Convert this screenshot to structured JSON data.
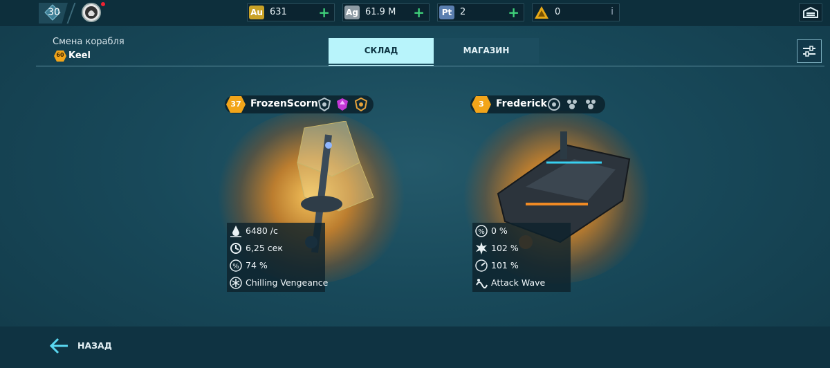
{
  "player": {
    "level": "30"
  },
  "resources": [
    {
      "code": "Au",
      "value": "631",
      "color": "#c9a227",
      "action": "plus"
    },
    {
      "code": "Ag",
      "value": "61.9 M",
      "color": "#8d9aa3",
      "action": "plus"
    },
    {
      "code": "Pt",
      "value": "2",
      "color": "#5b7fb0",
      "action": "plus"
    },
    {
      "code": "warning-triangle",
      "value": "0",
      "color": "#e6a817",
      "action": "info"
    }
  ],
  "header": {
    "title": "Смена корабля",
    "current_ship": {
      "level": "60",
      "name": "Keel"
    }
  },
  "tabs": [
    {
      "label": "СКЛАД",
      "active": true
    },
    {
      "label": "МАГАЗИН",
      "active": false
    }
  ],
  "ships": [
    {
      "level": "37",
      "name": "FrozenScorn",
      "modules": [
        "shield-module-icon",
        "magenta-upgrade-module-icon",
        "orange-shield-module-icon"
      ],
      "stats": [
        {
          "icon": "damage-drop-icon",
          "text": "6480 /с"
        },
        {
          "icon": "cooldown-icon",
          "text": "6,25 сек"
        },
        {
          "icon": "percent-icon",
          "text": "74 %"
        },
        {
          "icon": "snowflake-ability-icon",
          "text": "Chilling Vengeance"
        }
      ]
    },
    {
      "level": "3",
      "name": "Frederick",
      "modules": [
        "target-module-icon",
        "drone-module-icon",
        "drone-module-icon"
      ],
      "stats": [
        {
          "icon": "percent-icon",
          "text": "0 %"
        },
        {
          "icon": "burst-icon",
          "text": "102 %"
        },
        {
          "icon": "speed-gauge-icon",
          "text": "101 %"
        },
        {
          "icon": "wave-ability-icon",
          "text": "Attack Wave"
        }
      ]
    }
  ],
  "footer": {
    "back_label": "НАЗАД"
  },
  "colors": {
    "accent_gold": "#f2a51a",
    "tab_active": "#b8f4fb",
    "plus_green": "#3fd07a"
  }
}
